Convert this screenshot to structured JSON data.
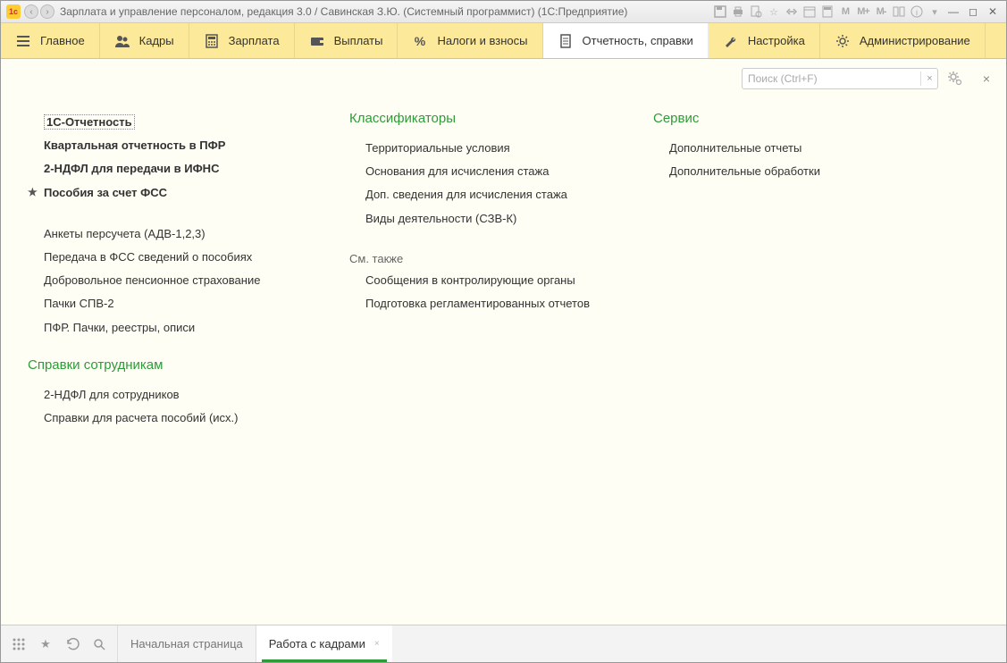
{
  "titlebar": {
    "title": "Зарплата и управление персоналом, редакция 3.0 / Савинская З.Ю. (Системный программист)  (1С:Предприятие)"
  },
  "toolbar": {
    "items": [
      {
        "label": "Главное"
      },
      {
        "label": "Кадры"
      },
      {
        "label": "Зарплата"
      },
      {
        "label": "Выплаты"
      },
      {
        "label": "Налоги и взносы"
      },
      {
        "label": "Отчетность, справки"
      },
      {
        "label": "Настройка"
      },
      {
        "label": "Администрирование"
      }
    ]
  },
  "search": {
    "placeholder": "Поиск (Ctrl+F)"
  },
  "col1": {
    "group1": [
      {
        "label": "1С-Отчетность",
        "selected": true
      },
      {
        "label": "Квартальная отчетность в ПФР",
        "bold": true
      },
      {
        "label": "2-НДФЛ для передачи в ИФНС",
        "bold": true
      },
      {
        "label": "Пособия за счет ФСС",
        "bold": true,
        "star": true
      }
    ],
    "group2": [
      {
        "label": "Анкеты персучета (АДВ-1,2,3)"
      },
      {
        "label": "Передача в ФСС сведений о пособиях"
      },
      {
        "label": "Добровольное пенсионное страхование"
      },
      {
        "label": "Пачки СПВ-2"
      },
      {
        "label": "ПФР. Пачки, реестры, описи"
      }
    ],
    "section2_header": "Справки сотрудникам",
    "group3": [
      {
        "label": "2-НДФЛ для сотрудников"
      },
      {
        "label": "Справки для расчета пособий (исх.)"
      }
    ]
  },
  "col2": {
    "section1_header": "Классификаторы",
    "group1": [
      {
        "label": "Территориальные условия"
      },
      {
        "label": "Основания для исчисления стажа"
      },
      {
        "label": "Доп. сведения для исчисления стажа"
      },
      {
        "label": "Виды деятельности (СЗВ-К)"
      }
    ],
    "see_also": "См. также",
    "group2": [
      {
        "label": "Сообщения в контролирующие органы"
      },
      {
        "label": "Подготовка регламентированных отчетов"
      }
    ]
  },
  "col3": {
    "section1_header": "Сервис",
    "group1": [
      {
        "label": "Дополнительные отчеты"
      },
      {
        "label": "Дополнительные обработки"
      }
    ]
  },
  "bottombar": {
    "tabs": [
      {
        "label": "Начальная страница"
      },
      {
        "label": "Работа с кадрами"
      }
    ]
  }
}
